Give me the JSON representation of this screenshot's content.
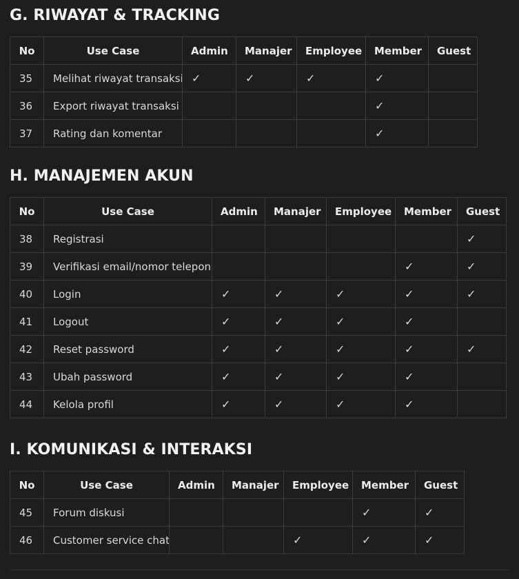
{
  "columns": [
    "No",
    "Use Case",
    "Admin",
    "Manajer",
    "Employee",
    "Member",
    "Guest"
  ],
  "check_symbol": "✓",
  "sections": [
    {
      "title": "G. RIWAYAT & TRACKING",
      "rows": [
        {
          "no": "35",
          "use_case": "Melihat riwayat transaksi",
          "marks": [
            "✓",
            "✓",
            "✓",
            "✓",
            ""
          ]
        },
        {
          "no": "36",
          "use_case": "Export riwayat transaksi",
          "marks": [
            "",
            "",
            "",
            "✓",
            ""
          ]
        },
        {
          "no": "37",
          "use_case": "Rating dan komentar",
          "marks": [
            "",
            "",
            "",
            "✓",
            ""
          ]
        }
      ]
    },
    {
      "title": "H. MANAJEMEN AKUN",
      "rows": [
        {
          "no": "38",
          "use_case": "Registrasi",
          "marks": [
            "",
            "",
            "",
            "",
            "✓"
          ]
        },
        {
          "no": "39",
          "use_case": "Verifikasi email/nomor telepon",
          "marks": [
            "",
            "",
            "",
            "✓",
            "✓"
          ]
        },
        {
          "no": "40",
          "use_case": "Login",
          "marks": [
            "✓",
            "✓",
            "✓",
            "✓",
            "✓"
          ]
        },
        {
          "no": "41",
          "use_case": "Logout",
          "marks": [
            "✓",
            "✓",
            "✓",
            "✓",
            ""
          ]
        },
        {
          "no": "42",
          "use_case": "Reset password",
          "marks": [
            "✓",
            "✓",
            "✓",
            "✓",
            "✓"
          ]
        },
        {
          "no": "43",
          "use_case": "Ubah password",
          "marks": [
            "✓",
            "✓",
            "✓",
            "✓",
            ""
          ]
        },
        {
          "no": "44",
          "use_case": "Kelola profil",
          "marks": [
            "✓",
            "✓",
            "✓",
            "✓",
            ""
          ]
        }
      ]
    },
    {
      "title": "I. KOMUNIKASI & INTERAKSI",
      "rows": [
        {
          "no": "45",
          "use_case": "Forum diskusi",
          "marks": [
            "",
            "",
            "",
            "✓",
            "✓"
          ]
        },
        {
          "no": "46",
          "use_case": "Customer service chat",
          "marks": [
            "",
            "",
            "✓",
            "✓",
            "✓"
          ]
        }
      ]
    }
  ]
}
